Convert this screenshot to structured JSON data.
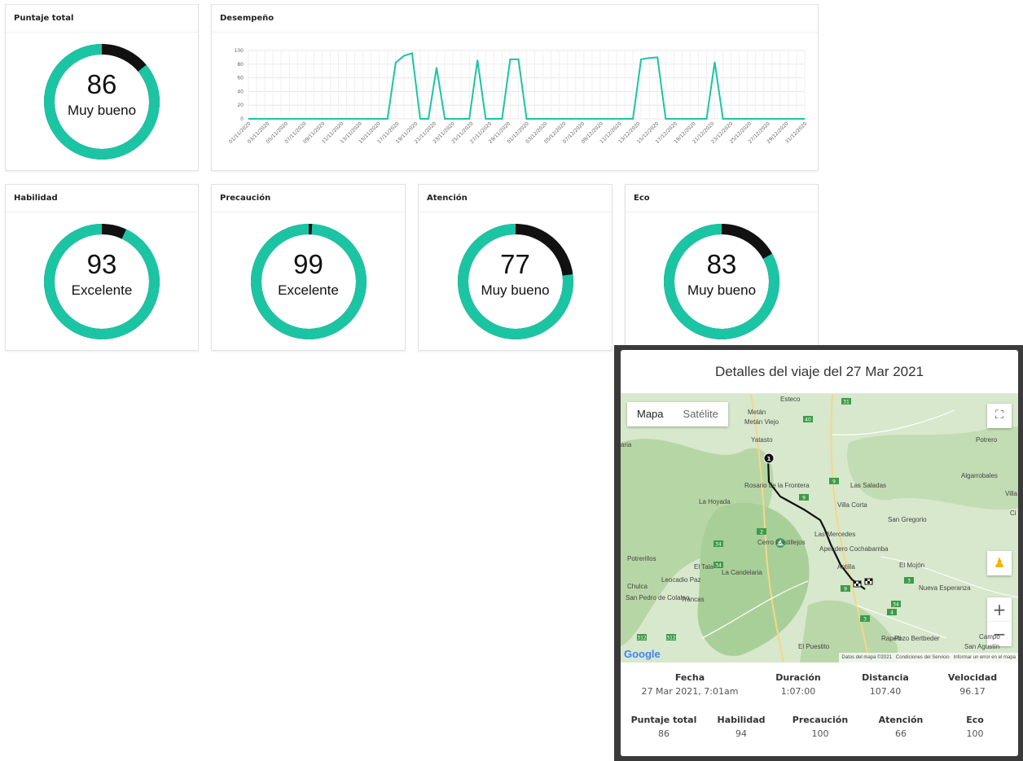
{
  "cards": {
    "total": {
      "title": "Puntaje total",
      "value": "86",
      "label": "Muy bueno",
      "fraction": 0.86
    },
    "performance": {
      "title": "Desempeño"
    },
    "skill": {
      "title": "Habilidad",
      "value": "93",
      "label": "Excelente",
      "fraction": 0.93
    },
    "caution": {
      "title": "Precaución",
      "value": "99",
      "label": "Excelente",
      "fraction": 0.99
    },
    "attention": {
      "title": "Atención",
      "value": "77",
      "label": "Muy bueno",
      "fraction": 0.77
    },
    "eco": {
      "title": "Eco",
      "value": "83",
      "label": "Muy bueno",
      "fraction": 0.83
    }
  },
  "colors": {
    "accent": "#1bc5a4",
    "remainder": "#111111"
  },
  "chart_data": {
    "type": "line",
    "title": "Desempeño",
    "ylim": [
      0,
      100
    ],
    "yticks": [
      0,
      20,
      40,
      60,
      80,
      100
    ],
    "grid": true,
    "x_tick_labels": [
      "01/11/2020",
      "03/11/2020",
      "05/11/2020",
      "07/11/2020",
      "09/11/2020",
      "11/11/2020",
      "13/11/2020",
      "15/11/2020",
      "17/11/2020",
      "19/11/2020",
      "21/11/2020",
      "23/11/2020",
      "25/11/2020",
      "27/11/2020",
      "29/11/2020",
      "01/12/2020",
      "03/12/2020",
      "05/12/2020",
      "07/12/2020",
      "09/12/2020",
      "11/12/2020",
      "13/12/2020",
      "15/12/2020",
      "17/12/2020",
      "19/12/2020",
      "21/12/2020",
      "23/12/2020",
      "25/12/2020",
      "27/12/2020",
      "29/12/2020",
      "31/12/2020"
    ],
    "series": [
      {
        "color": "#1bc5a4",
        "values": [
          0,
          0,
          0,
          0,
          0,
          0,
          0,
          0,
          0,
          0,
          0,
          0,
          0,
          0,
          0,
          0,
          0,
          0,
          82,
          92,
          96,
          0,
          0,
          75,
          0,
          0,
          0,
          0,
          86,
          0,
          0,
          0,
          87,
          87,
          0,
          0,
          0,
          0,
          0,
          0,
          0,
          0,
          0,
          0,
          0,
          0,
          0,
          0,
          87,
          89,
          90,
          0,
          0,
          0,
          0,
          0,
          0,
          83,
          0,
          0,
          0,
          0,
          0,
          0,
          0,
          0,
          0,
          0,
          0
        ]
      }
    ]
  },
  "trip": {
    "title": "Detalles del viaje del 27 Mar 2021",
    "map": {
      "tab_map": "Mapa",
      "tab_satellite": "Satélite",
      "google": "Google",
      "footer_data": "Datos del mapa ©2021",
      "footer_terms": "Condiciones del Servicio",
      "footer_report": "Informar un error en el mapa",
      "start_marker": "1",
      "places": [
        "Esteco",
        "Metán",
        "Metán Viejo",
        "Yatasto",
        "Rosario de la Frontera",
        "La Hoyada",
        "Las Saladas",
        "Villa Corta",
        "San Gregorio",
        "Las Mercedes",
        "Cerro Castillejos",
        "Apeadero Cochabamba",
        "Potrerillos",
        "El Tala",
        "La Candelaria",
        "Antilla",
        "El Mojón",
        "Leocadio Paz",
        "Chulca",
        "San Pedro de Colalao",
        "Trancas",
        "Nueva Esperanza",
        "Rapelli",
        "El Puestito",
        "Pozo Bertbeder",
        "San Agustín",
        "Potrero",
        "Algarrobales",
        "Campo",
        "Villa",
        "aria",
        "Ci"
      ],
      "roads": [
        "31",
        "40",
        "9",
        "9",
        "34",
        "34",
        "2",
        "9",
        "3",
        "34",
        "4",
        "3",
        "312",
        "312"
      ]
    },
    "stats_row1": [
      {
        "label": "Fecha",
        "value": "27 Mar 2021, 7:01am"
      },
      {
        "label": "Duración",
        "value": "1:07:00"
      },
      {
        "label": "Distancia",
        "value": "107.40"
      },
      {
        "label": "Velocidad",
        "value": "96.17"
      }
    ],
    "stats_row2": [
      {
        "label": "Puntaje total",
        "value": "86"
      },
      {
        "label": "Habilidad",
        "value": "94"
      },
      {
        "label": "Precaución",
        "value": "100"
      },
      {
        "label": "Atención",
        "value": "66"
      },
      {
        "label": "Eco",
        "value": "100"
      }
    ]
  }
}
